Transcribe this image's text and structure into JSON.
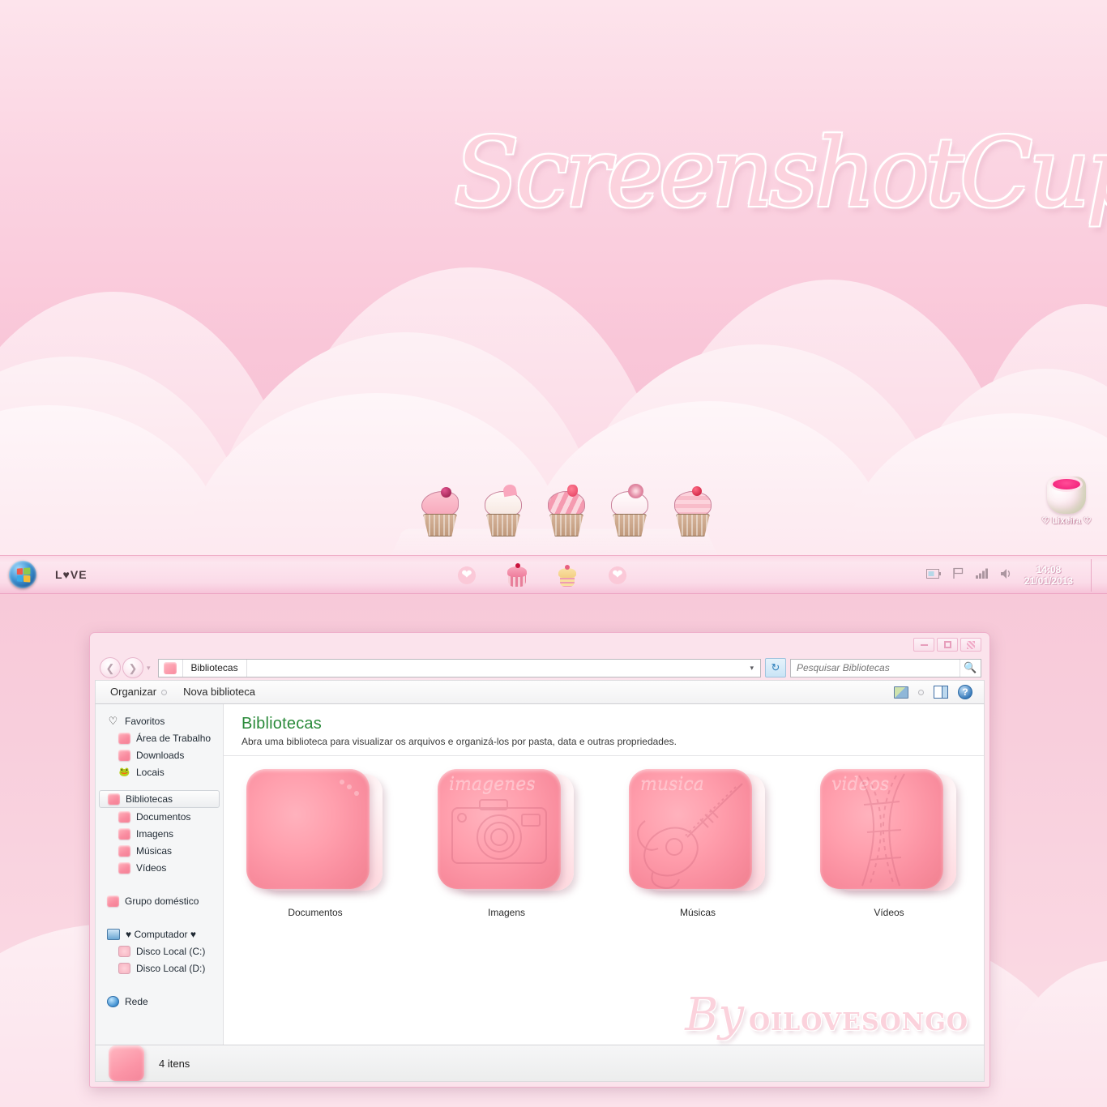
{
  "wallpaper": {
    "title": "ScreenshotCupcake",
    "cupcake_count": 5,
    "colors": {
      "pink_light": "#fde9f0",
      "pink_mid": "#fbd4e2",
      "pink_deep": "#f6bed2"
    }
  },
  "desktop": {
    "recycle_bin": {
      "label": "♡ Lixeira ♡",
      "icon": "recycle-bin-icon"
    }
  },
  "taskbar": {
    "start_orb": "windows-start-icon",
    "toolbar_label": "L♥VE",
    "pinned": [
      {
        "name": "heart-badge-icon"
      },
      {
        "name": "cupcake-pink-icon"
      },
      {
        "name": "cupcake-yellow-icon"
      },
      {
        "name": "heart-badge-icon"
      }
    ],
    "tray": {
      "battery": "battery-icon",
      "flag": "action-center-flag-icon",
      "network": "network-signal-icon",
      "volume": "volume-icon",
      "time": "14:08",
      "date": "21/01/2013"
    }
  },
  "window": {
    "controls": {
      "minimize": "minimize-button",
      "maximize": "maximize-button",
      "close": "close-button"
    },
    "address": {
      "back": "back-button",
      "forward": "forward-button",
      "history_dropdown": "history-dropdown",
      "crumb_icon": "libraries-folder-icon",
      "crumb": "Bibliotecas",
      "dropdown": "▾",
      "refresh": "refresh-button"
    },
    "search": {
      "placeholder": "Pesquisar Bibliotecas",
      "value": "",
      "icon": "search-icon"
    },
    "command_bar": {
      "organize": "Organizar",
      "new_library": "Nova biblioteca",
      "preview_pane": "preview-pane-icon",
      "help": "help-icon"
    },
    "navpane": {
      "groups": [
        {
          "header": {
            "label": "Favoritos",
            "icon": "heart-icon"
          },
          "items": [
            {
              "label": "Área de Trabalho",
              "icon": "pink-folder-icon"
            },
            {
              "label": "Downloads",
              "icon": "pink-folder-icon"
            },
            {
              "label": "Locais",
              "icon": "panda-icon"
            }
          ]
        },
        {
          "header": {
            "label": "Bibliotecas",
            "icon": "pink-folder-icon",
            "selected": true
          },
          "items": [
            {
              "label": "Documentos",
              "icon": "pink-folder-icon"
            },
            {
              "label": "Imagens",
              "icon": "pink-folder-icon"
            },
            {
              "label": "Músicas",
              "icon": "pink-folder-icon"
            },
            {
              "label": "Vídeos",
              "icon": "pink-folder-icon"
            }
          ]
        },
        {
          "header": {
            "label": "Grupo doméstico",
            "icon": "pink-folder-icon"
          },
          "items": []
        },
        {
          "header": {
            "label": "♥ Computador ♥",
            "icon": "computer-icon"
          },
          "items": [
            {
              "label": "Disco Local (C:)",
              "icon": "disk-icon"
            },
            {
              "label": "Disco Local (D:)",
              "icon": "disk-icon"
            }
          ]
        },
        {
          "header": {
            "label": "Rede",
            "icon": "network-icon"
          },
          "items": []
        }
      ]
    },
    "content": {
      "title": "Bibliotecas",
      "subtitle": "Abra uma biblioteca para visualizar os arquivos e organizá-los por pasta, data e outras propriedades.",
      "tiles": [
        {
          "label": "Documentos",
          "script": "",
          "art": "dots-art"
        },
        {
          "label": "Imagens",
          "script": "imagenes",
          "art": "camera-art"
        },
        {
          "label": "Músicas",
          "script": "musica",
          "art": "guitar-art"
        },
        {
          "label": "Vídeos",
          "script": "videos",
          "art": "filmstrip-art"
        }
      ]
    },
    "status_bar": {
      "icon": "libraries-icon",
      "text": "4 itens"
    }
  },
  "watermark": {
    "by": "By",
    "name": "OILOVESONGO"
  }
}
